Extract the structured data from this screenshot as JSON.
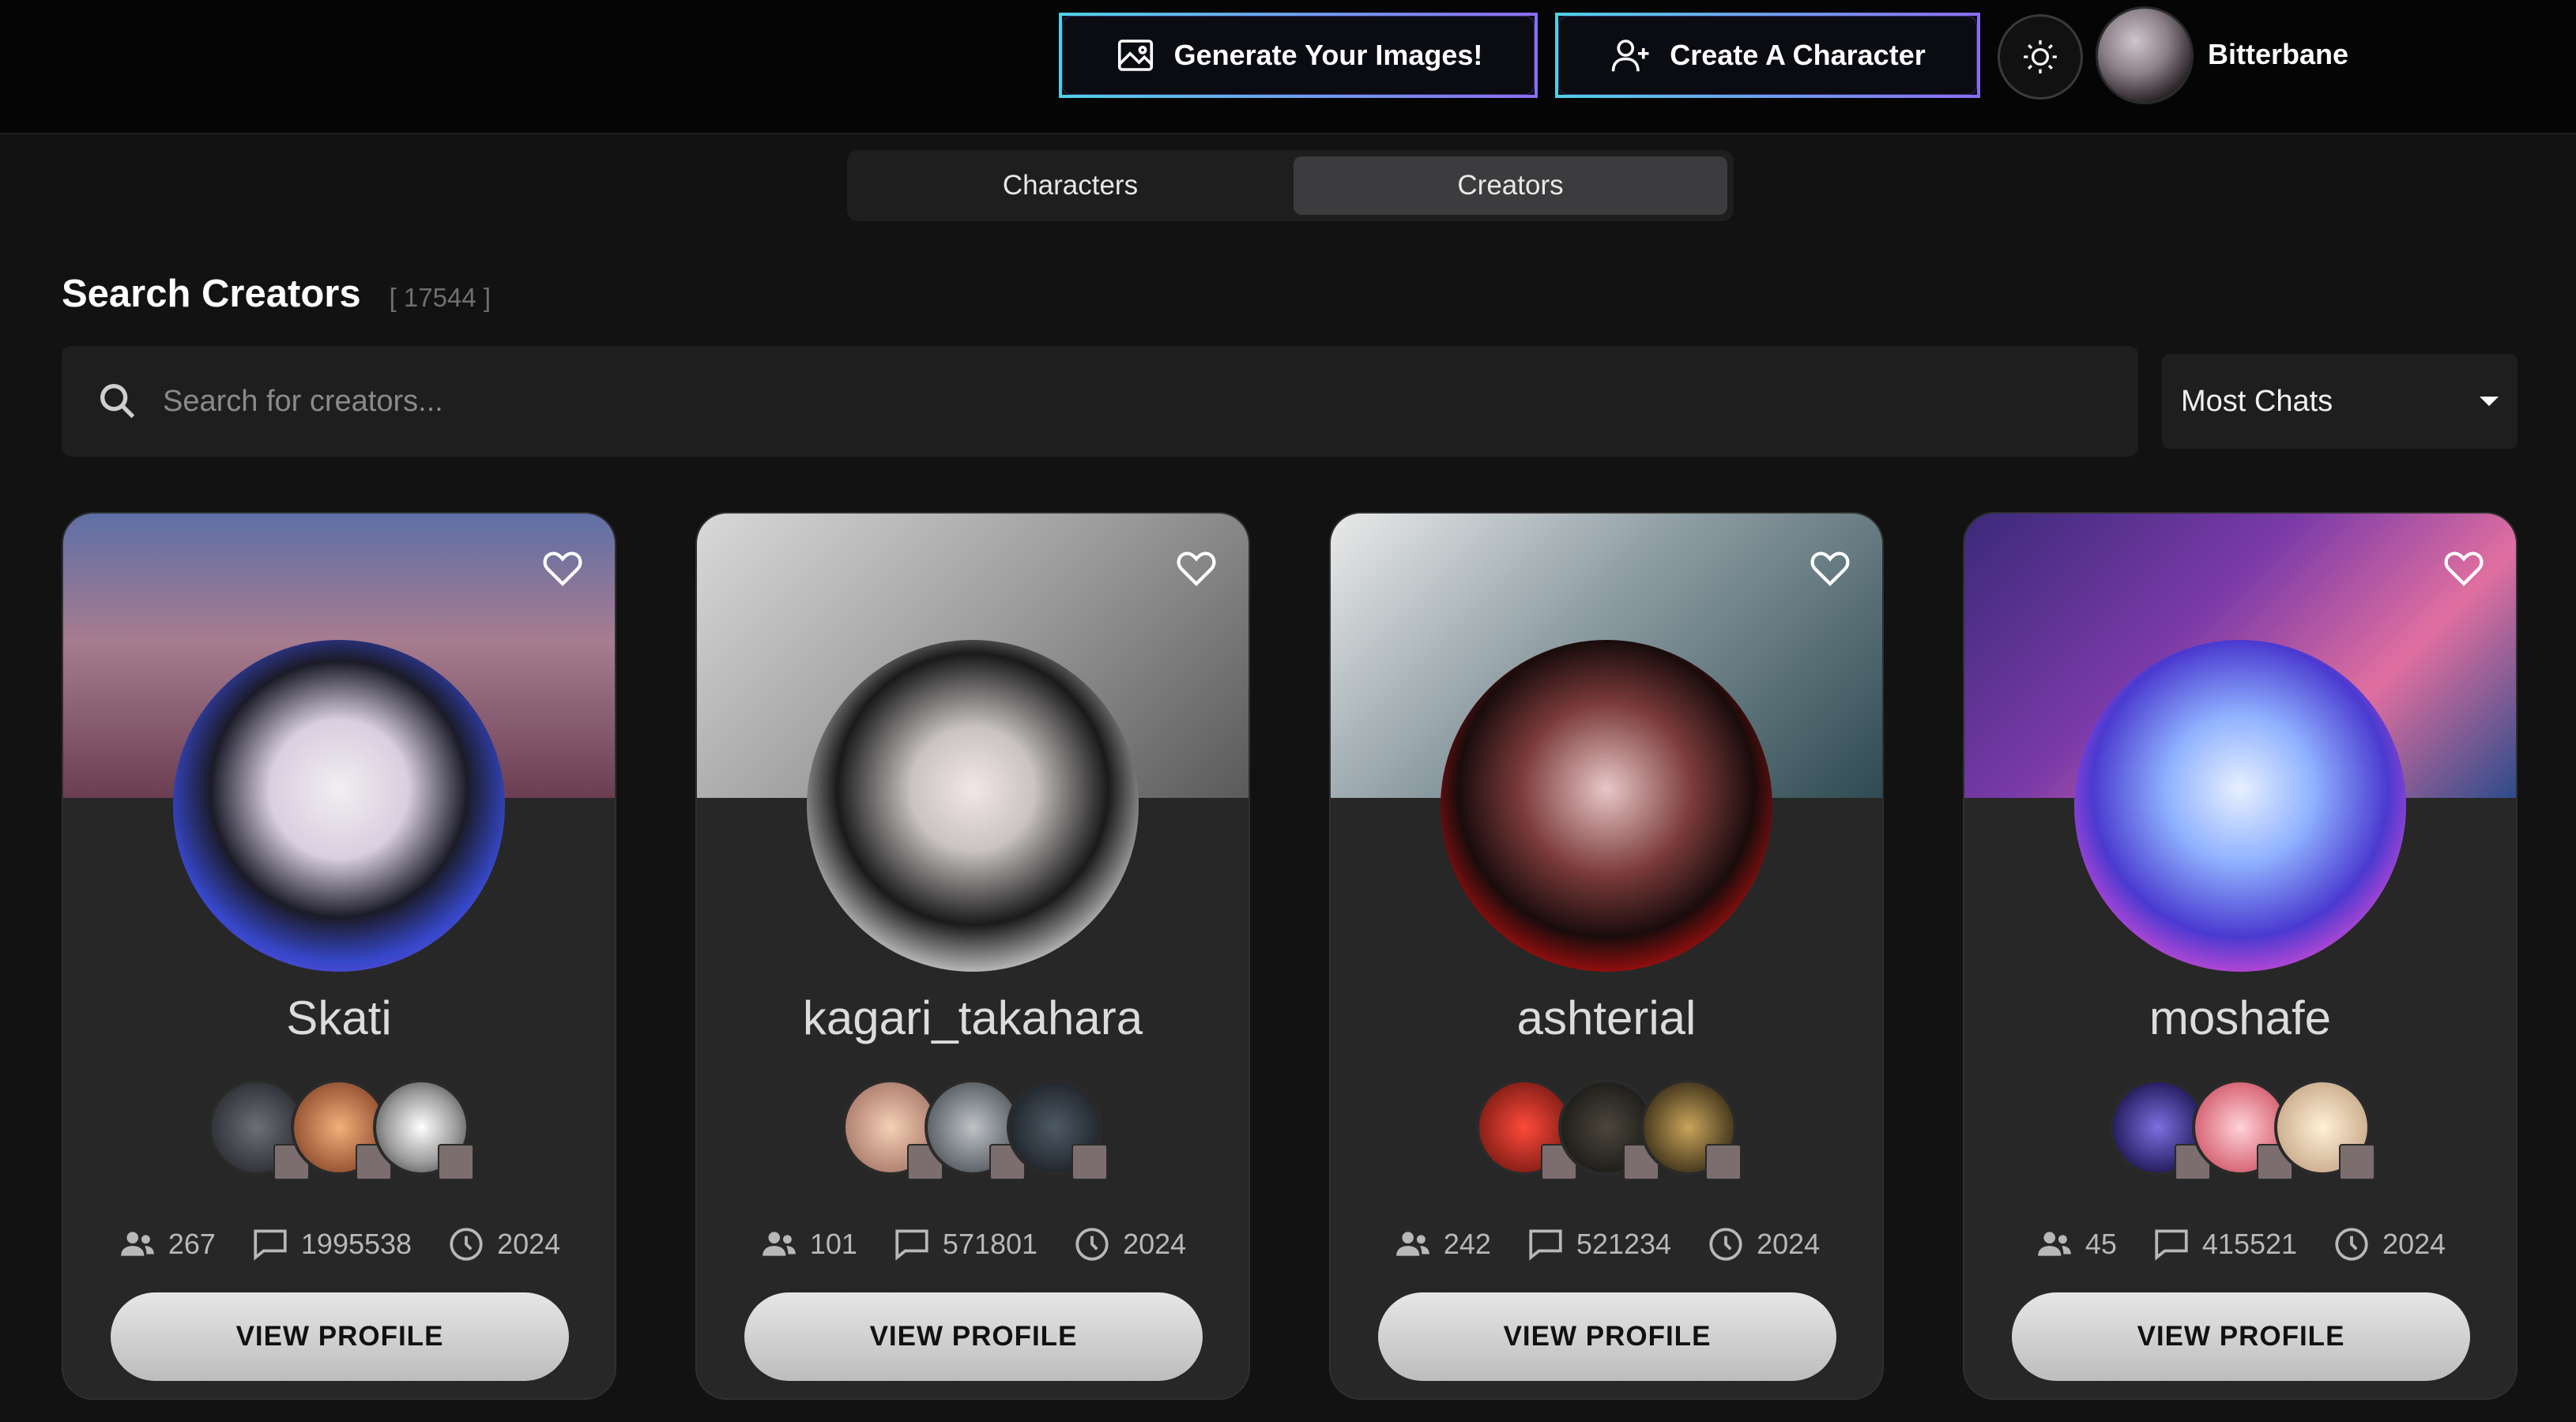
{
  "header": {
    "generate_label": "Generate Your Images!",
    "create_label": "Create A Character",
    "user_name": "Bitterbane"
  },
  "tabs": [
    {
      "label": "Characters",
      "active": false
    },
    {
      "label": "Creators",
      "active": true
    }
  ],
  "search": {
    "title": "Search Creators",
    "count": "[ 17544 ]",
    "placeholder": "Search for creators...",
    "sort_value": "Most Chats"
  },
  "creators": [
    {
      "name": "Skati",
      "followers": "267",
      "chats": "1995538",
      "year": "2024",
      "button_label": "VIEW PROFILE"
    },
    {
      "name": "kagari_takahara",
      "followers": "101",
      "chats": "571801",
      "year": "2024",
      "button_label": "VIEW PROFILE"
    },
    {
      "name": "ashterial",
      "followers": "242",
      "chats": "521234",
      "year": "2024",
      "button_label": "VIEW PROFILE"
    },
    {
      "name": "moshafe",
      "followers": "45",
      "chats": "415521",
      "year": "2024",
      "button_label": "VIEW PROFILE"
    }
  ],
  "icons": {
    "image": "image-icon",
    "person_add": "person-add-icon",
    "sun": "sun-icon",
    "search": "search-icon",
    "heart": "heart-icon",
    "people": "people-icon",
    "chat": "chat-icon",
    "clock": "clock-icon"
  },
  "colors": {
    "accent_cyan": "#4fd0e6",
    "accent_violet": "#8a6cf0",
    "card_bg": "#272727",
    "page_bg": "#121212"
  }
}
